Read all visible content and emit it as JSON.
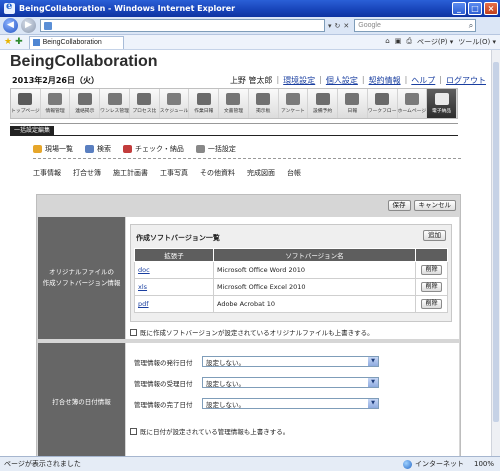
{
  "window": {
    "title": "BeingCollaboration - Windows Internet Explorer"
  },
  "browser": {
    "search_placeholder": "Google",
    "tab_title": "BeingCollaboration",
    "tools": [
      "⌂",
      "▣",
      "⎙",
      "ページ(P) ▾",
      "ツール(O) ▾"
    ],
    "status_text": "ページが表示されました",
    "zone": "インターネット",
    "zoom": "100%"
  },
  "header": {
    "brand": "BeingCollaboration",
    "date": "2013年2月26日（火）",
    "user": "上野 管太郎",
    "links": [
      "環境設定",
      "個人設定",
      "契約情報",
      "ヘルプ",
      "ログアウト"
    ]
  },
  "menu": [
    {
      "label": "トップページ",
      "color": "#5a5a5a"
    },
    {
      "label": "情報管理",
      "color": "#7a7a7a"
    },
    {
      "label": "連絡掲示",
      "color": "#6e6e6e"
    },
    {
      "label": "ワンレス管理",
      "color": "#777777"
    },
    {
      "label": "プロセス比",
      "color": "#6d6d6d"
    },
    {
      "label": "スケジュール",
      "color": "#7d7d7d"
    },
    {
      "label": "作業日報",
      "color": "#6a6a6a"
    },
    {
      "label": "文書管理",
      "color": "#747474"
    },
    {
      "label": "掲示板",
      "color": "#707070"
    },
    {
      "label": "アンケート",
      "color": "#7a7a7a"
    },
    {
      "label": "設備予約",
      "color": "#6d6d6d"
    },
    {
      "label": "日報",
      "color": "#737373"
    },
    {
      "label": "ワークフロー",
      "color": "#696969"
    },
    {
      "label": "ホームページ",
      "color": "#7a7a7a"
    },
    {
      "label": "電子納品",
      "color": "#eaeaea",
      "active": true
    }
  ],
  "section": {
    "tab_label": "一括設定編集"
  },
  "subnav": [
    {
      "label": "現場一覧",
      "icon": "folder-icon",
      "color": "#e6a62a"
    },
    {
      "label": "検索",
      "icon": "search-icon",
      "color": "#5a7fc0"
    },
    {
      "label": "チェック・納品",
      "icon": "check-icon",
      "color": "#c23c3c"
    },
    {
      "label": "一括設定",
      "icon": "settings-icon",
      "color": "#888888"
    }
  ],
  "subnav2": [
    {
      "label": "工事情報",
      "icon": "info-icon"
    },
    {
      "label": "打合せ簿",
      "icon": "note-icon"
    },
    {
      "label": "施工計画書",
      "icon": "plan-icon"
    },
    {
      "label": "工事写真",
      "icon": "photo-icon"
    },
    {
      "label": "その他資料",
      "icon": "docs-icon"
    },
    {
      "label": "完成図面",
      "icon": "drawing-icon"
    },
    {
      "label": "台帳",
      "icon": "ledger-icon"
    }
  ],
  "panel": {
    "save_label": "保存",
    "cancel_label": "キャンセル",
    "software": {
      "row_label_line1": "オリジナルファイルの",
      "row_label_line2": "作成ソフトバージョン情報",
      "list_title": "作成ソフトバージョン一覧",
      "add_label": "追加",
      "col_ext": "拡張子",
      "col_name": "ソフトバージョン名",
      "rows": [
        {
          "ext": "doc",
          "name": "Microsoft Office Word 2010",
          "action": "削除"
        },
        {
          "ext": "xls",
          "name": "Microsoft Office Excel 2010",
          "action": "削除"
        },
        {
          "ext": "pdf",
          "name": "Adobe Acrobat 10",
          "action": "削除"
        }
      ],
      "overwrite_label": "既に作成ソフトバージョンが設定されているオリジナルファイルも上書きする。"
    },
    "dates": {
      "row_label": "打合せ簿の日付情報",
      "fields": [
        {
          "label": "管理情報の発行日付",
          "value": "設定しない。"
        },
        {
          "label": "管理情報の受理日付",
          "value": "設定しない。"
        },
        {
          "label": "管理情報の完了日付",
          "value": "設定しない。"
        }
      ],
      "overwrite_label": "既に日付が設定されている管理情報も上書きする。"
    }
  }
}
